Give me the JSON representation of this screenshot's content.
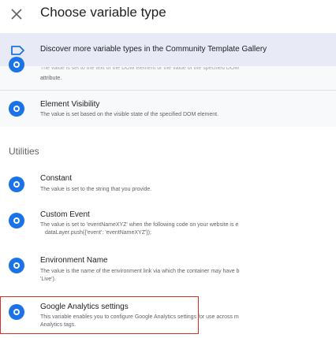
{
  "header": {
    "title": "Choose variable type"
  },
  "gallery": {
    "label": "Discover more variable types in the Community Template Gallery"
  },
  "partial_item": {
    "desc_top": "The value is set to the text of the DOM element or the value of the specified DOM",
    "desc_bottom": "attribute."
  },
  "element_visibility": {
    "title": "Element Visibility",
    "desc": "The value is set based on the visible state of the specified DOM element."
  },
  "utilities": {
    "heading": "Utilities",
    "items": [
      {
        "title": "Constant",
        "desc_lines": [
          "The value is set to the string that you provide."
        ]
      },
      {
        "title": "Custom Event",
        "desc_lines": [
          "The value is set to 'eventNameXYZ' when the following code on your website is e",
          "dataLayer.push({'event': 'eventNameXYZ'});"
        ]
      },
      {
        "title": "Environment Name",
        "desc_lines": [
          "The value is the name of the environment link via which the container may have b",
          "'Live')."
        ]
      },
      {
        "title": "Google Analytics settings",
        "desc_lines": [
          "This variable enables you to configure Google Analytics settings for use across m",
          "Analytics tags."
        ]
      }
    ]
  },
  "colors": {
    "accent": "#1a73e8",
    "banner_bg": "#e8eaf6",
    "highlight": "#d93025"
  }
}
